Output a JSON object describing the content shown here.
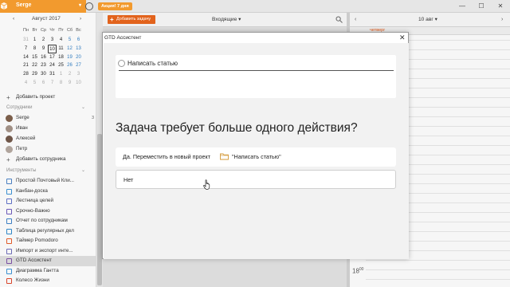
{
  "titlebar": {
    "user": "Serge",
    "promo_badge": "Акция! 7 дня",
    "buttons": [
      "—",
      "☐",
      "✕"
    ]
  },
  "calendar": {
    "month": "Август 2017",
    "prev": "‹",
    "next": "›",
    "weekdays": [
      "Пн",
      "Вт",
      "Ср",
      "Чт",
      "Пт",
      "Сб",
      "Вс"
    ],
    "weeks": [
      [
        "31",
        "1",
        "2",
        "3",
        "4",
        "5",
        "6"
      ],
      [
        "7",
        "8",
        "9",
        "10",
        "11",
        "12",
        "13"
      ],
      [
        "14",
        "15",
        "16",
        "17",
        "18",
        "19",
        "20"
      ],
      [
        "21",
        "22",
        "23",
        "24",
        "25",
        "26",
        "27"
      ],
      [
        "28",
        "29",
        "30",
        "31",
        "1",
        "2",
        "3"
      ],
      [
        "4",
        "5",
        "6",
        "7",
        "8",
        "9",
        "10"
      ]
    ],
    "selected": "10"
  },
  "sidebar": {
    "add_project": "Добавить проект",
    "employees_header": "Сотрудники",
    "employees": [
      {
        "name": "Serge",
        "count": "3"
      },
      {
        "name": "Иван",
        "count": ""
      },
      {
        "name": "Алексей",
        "count": ""
      },
      {
        "name": "Петр",
        "count": ""
      }
    ],
    "add_employee": "Добавить сотрудника",
    "tools_header": "Инструменты",
    "tools": [
      "Простой Почтовый Кли...",
      "Канбан-доска",
      "Лестница целей",
      "Срочно-Важно",
      "Отчет по сотрудникам",
      "Таблица регулярных дел",
      "Таймер Pomodoro",
      "Импорт и экспорт инте...",
      "GTD Ассистент",
      "Диаграмма Гантта",
      "Колесо Жизни"
    ],
    "active_tool": "GTD Ассистент"
  },
  "tasks": {
    "add_button": "Добавить задачу",
    "filter": "Входящие ▾"
  },
  "calview": {
    "date": "10 авг ▾",
    "day_label": "четверг",
    "hour": "18",
    "hour_suffix": "00"
  },
  "modal": {
    "title": "GTD Ассистент",
    "close": "✕",
    "task_title": "Написать статью",
    "question": "Задача требует больше одного действия?",
    "yes_label": "Да. Переместить в новый проект",
    "yes_project": "\"Написать статью\"",
    "no_label": "Нет"
  },
  "colors": {
    "brand": "#f29a2e",
    "add_button": "#e2631c",
    "weekend": "#2f7bbf"
  }
}
